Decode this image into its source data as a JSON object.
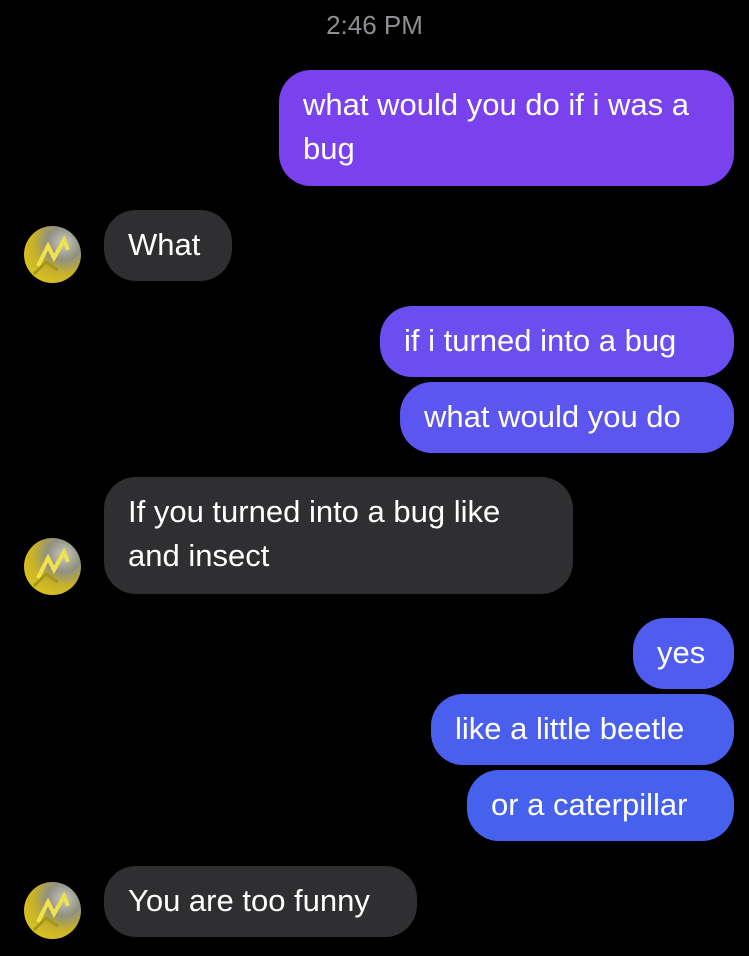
{
  "conversation": {
    "timestamp": "2:46 PM",
    "messages": [
      {
        "sender": "me",
        "text": "what would you do if i was a bug",
        "color": "#7a41ee"
      },
      {
        "sender": "them",
        "text": "What"
      },
      {
        "sender": "me",
        "text": "if i turned into a bug",
        "color": "#6a4ef0"
      },
      {
        "sender": "me",
        "text": "what would you do",
        "color": "#5c55ef"
      },
      {
        "sender": "them",
        "text": "If you turned into a bug like and insect"
      },
      {
        "sender": "me",
        "text": "yes",
        "color": "#4f5cef"
      },
      {
        "sender": "me",
        "text": "like a little beetle",
        "color": "#4a5fee"
      },
      {
        "sender": "me",
        "text": "or a caterpillar",
        "color": "#4661ee"
      },
      {
        "sender": "them",
        "text": "You are too funny"
      }
    ]
  },
  "icons": {
    "avatar": "contact-avatar-yellow-sketch"
  },
  "colors": {
    "background": "#000000",
    "incoming_bubble": "#2f2f31",
    "timestamp": "#8e8e93"
  }
}
